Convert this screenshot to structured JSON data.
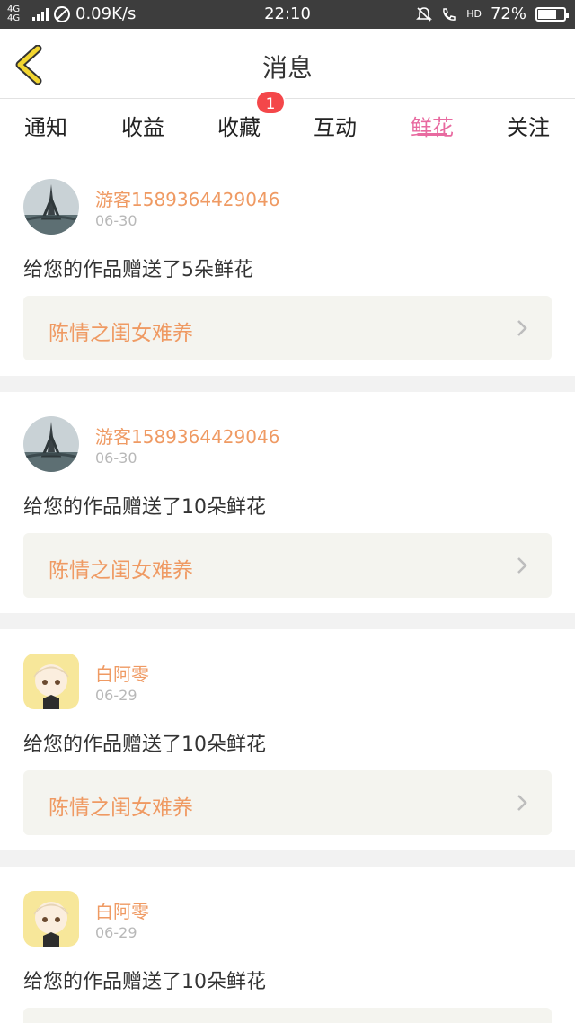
{
  "status_bar": {
    "network": "4G 4G",
    "speed": "0.09K/s",
    "time": "22:10",
    "hd": "HD",
    "battery": "72%",
    "battery_level": 0.72
  },
  "header": {
    "title": "消息",
    "back_icon": "chevron-left-icon"
  },
  "tabs": [
    {
      "label": "通知",
      "active": false
    },
    {
      "label": "收益",
      "active": false
    },
    {
      "label": "收藏",
      "active": false,
      "badge": "1"
    },
    {
      "label": "互动",
      "active": false
    },
    {
      "label": "鲜花",
      "active": true
    },
    {
      "label": "关注",
      "active": false
    }
  ],
  "messages": [
    {
      "user": "游客1589364429046",
      "date": "06-30",
      "text": "给您的作品赠送了5朵鲜花",
      "work": "陈情之闺女难养",
      "avatar": "eiffel-tower"
    },
    {
      "user": "游客1589364429046",
      "date": "06-30",
      "text": "给您的作品赠送了10朵鲜花",
      "work": "陈情之闺女难养",
      "avatar": "eiffel-tower"
    },
    {
      "user": "白阿零",
      "date": "06-29",
      "text": "给您的作品赠送了10朵鲜花",
      "work": "陈情之闺女难养",
      "avatar": "anime-character"
    },
    {
      "user": "白阿零",
      "date": "06-29",
      "text": "给您的作品赠送了10朵鲜花",
      "work": "",
      "avatar": "anime-character"
    }
  ],
  "colors": {
    "accent_pink": "#e86aa0",
    "username_orange": "#ef9a63",
    "back_yellow": "#f3d630",
    "badge_red": "#f4474a"
  }
}
